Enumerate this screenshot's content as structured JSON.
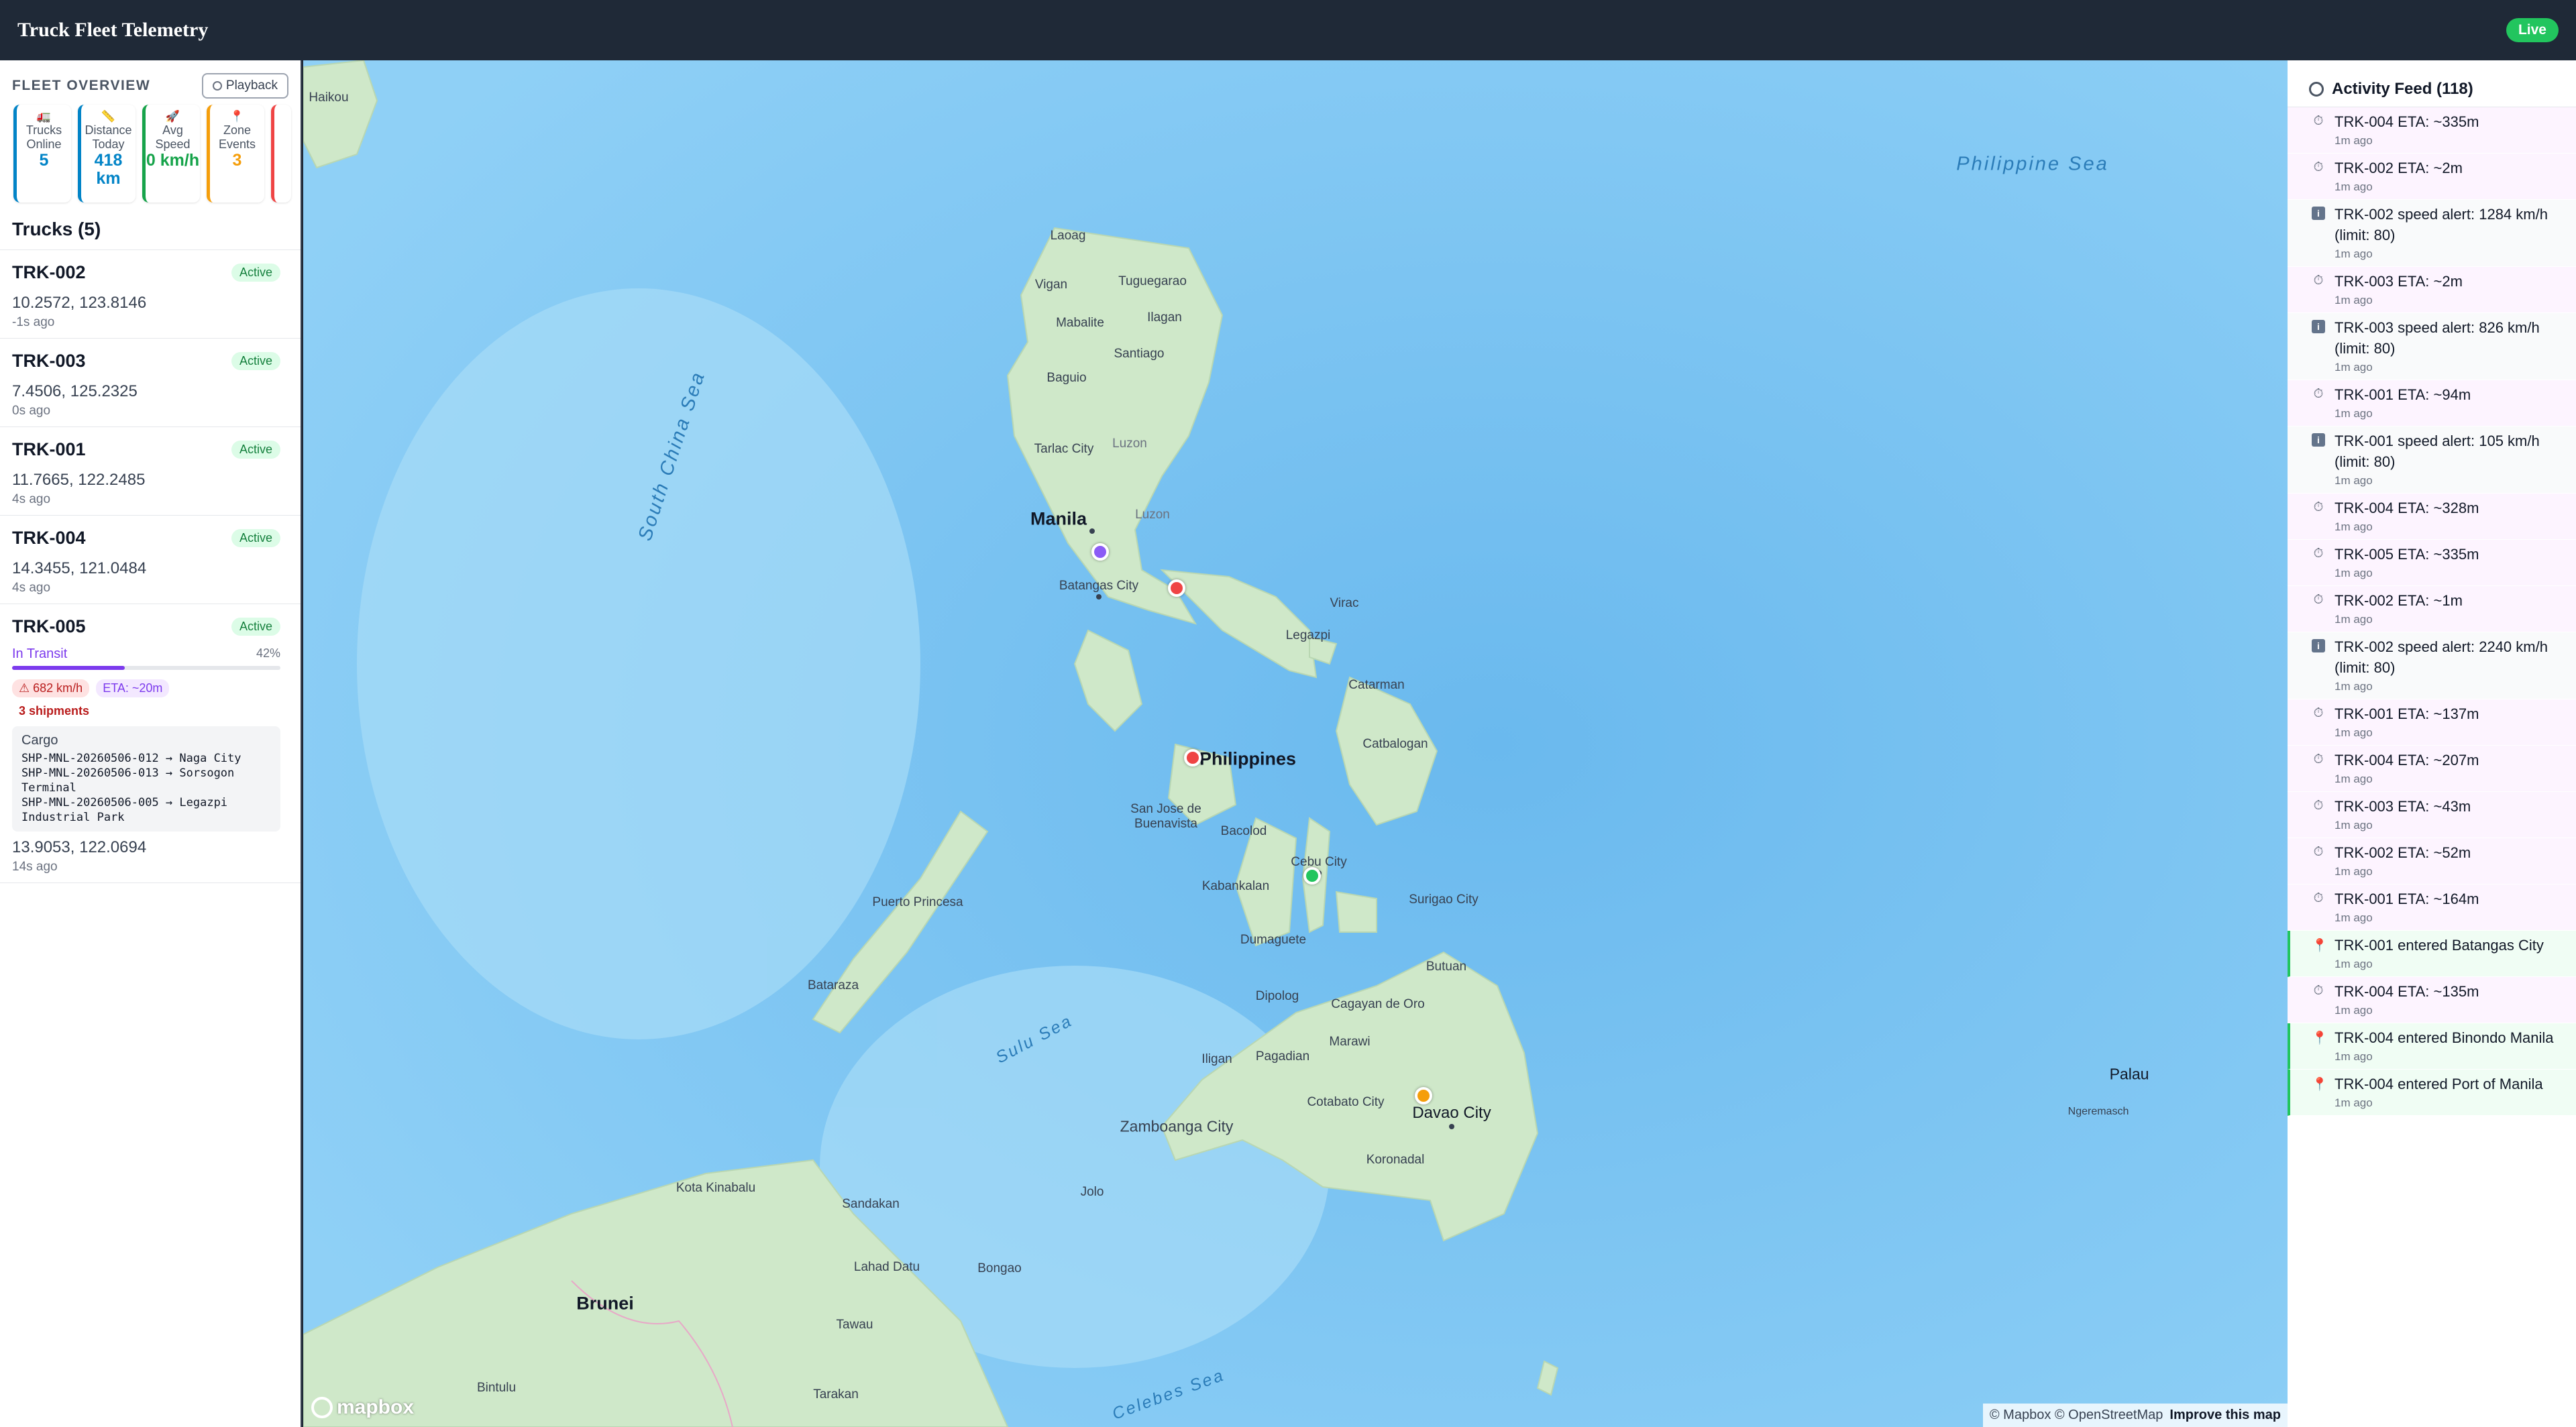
{
  "header": {
    "title": "Truck Fleet Telemetry",
    "live": "Live"
  },
  "overview": {
    "title": "FLEET OVERVIEW",
    "playback": "Playback",
    "stats": [
      {
        "icon": "🚛",
        "label": "Trucks Online",
        "value": "5",
        "color": "#0284c7"
      },
      {
        "icon": "📏",
        "label": "Distance Today",
        "value": "418 km",
        "color": "#0284c7"
      },
      {
        "icon": "🚀",
        "label": "Avg Speed",
        "value": "0 km/h",
        "color": "#16a34a"
      },
      {
        "icon": "📍",
        "label": "Zone Events",
        "value": "3",
        "color": "#f59e0b"
      }
    ]
  },
  "trucks": {
    "title": "Trucks (5)",
    "items": [
      {
        "id": "TRK-002",
        "status": "Active",
        "coords": "10.2572, 123.8146",
        "ago": "-1s ago"
      },
      {
        "id": "TRK-003",
        "status": "Active",
        "coords": "7.4506, 125.2325",
        "ago": "0s ago"
      },
      {
        "id": "TRK-001",
        "status": "Active",
        "coords": "11.7665, 122.2485",
        "ago": "4s ago"
      },
      {
        "id": "TRK-004",
        "status": "Active",
        "coords": "14.3455, 121.0484",
        "ago": "4s ago"
      }
    ],
    "expanded": {
      "id": "TRK-005",
      "status": "Active",
      "transit_label": "In Transit",
      "progress_text": "42%",
      "progress": 42,
      "speed_alert": "⚠ 682 km/h",
      "eta": "ETA: ~20m",
      "shipments": "3 shipments",
      "cargo_title": "Cargo",
      "cargo": [
        "SHP-MNL-20260506-012 → Naga City",
        "SHP-MNL-20260506-013 → Sorsogon Terminal",
        "SHP-MNL-20260506-005 → Legazpi Industrial Park"
      ],
      "coords": "13.9053, 122.0694",
      "ago": "14s ago"
    }
  },
  "map": {
    "seas": [
      "South China Sea",
      "Philippine Sea",
      "Sulu Sea",
      "Celebes Sea"
    ],
    "labels": [
      "Haikou",
      "Laoag",
      "Vigan",
      "Tuguegarao",
      "Mabalite",
      "Ilagan",
      "Santiago",
      "Baguio",
      "Tarlac City",
      "Luzon",
      "Manila",
      "Luzon",
      "Batangas City",
      "Virac",
      "Legazpi",
      "Catarman",
      "Catbalogan",
      "Philippines",
      "San Jose de Buenavista",
      "Bacolod",
      "Cebu City",
      "Kabankalan",
      "Surigao City",
      "Dumaguete",
      "Puerto Princesa",
      "Butuan",
      "Bataraza",
      "Dipolog",
      "Cagayan de Oro",
      "Marawi",
      "Pagadian",
      "Iligan",
      "Cotabato City",
      "Davao City",
      "Zamboanga City",
      "Koronadal",
      "Kota Kinabalu",
      "Jolo",
      "Sandakan",
      "Lahad Datu",
      "Bongao",
      "Brunei",
      "Tawau",
      "Bintulu",
      "Tarakan",
      "Palau",
      "Ngeremasch"
    ],
    "logo": "mapbox",
    "attribution": "© Mapbox © OpenStreetMap",
    "improve": "Improve this map",
    "marker_colors": {
      "trk001": "#ef4444",
      "trk002": "#22c55e",
      "trk003": "#f59e0b",
      "trk004": "#8b5cf6",
      "trk005": "#ef4444"
    }
  },
  "feed": {
    "title": "Activity Feed (118)",
    "items": [
      {
        "type": "eta",
        "text": "TRK-004 ETA: ~335m",
        "ago": "1m ago"
      },
      {
        "type": "eta",
        "text": "TRK-002 ETA: ~2m",
        "ago": "1m ago"
      },
      {
        "type": "speed",
        "text": "TRK-002 speed alert: 1284 km/h (limit: 80)",
        "ago": "1m ago"
      },
      {
        "type": "eta",
        "text": "TRK-003 ETA: ~2m",
        "ago": "1m ago"
      },
      {
        "type": "speed",
        "text": "TRK-003 speed alert: 826 km/h (limit: 80)",
        "ago": "1m ago"
      },
      {
        "type": "eta",
        "text": "TRK-001 ETA: ~94m",
        "ago": "1m ago"
      },
      {
        "type": "speed",
        "text": "TRK-001 speed alert: 105 km/h (limit: 80)",
        "ago": "1m ago"
      },
      {
        "type": "eta",
        "text": "TRK-004 ETA: ~328m",
        "ago": "1m ago"
      },
      {
        "type": "eta",
        "text": "TRK-005 ETA: ~335m",
        "ago": "1m ago"
      },
      {
        "type": "eta",
        "text": "TRK-002 ETA: ~1m",
        "ago": "1m ago"
      },
      {
        "type": "speed",
        "text": "TRK-002 speed alert: 2240 km/h (limit: 80)",
        "ago": "1m ago"
      },
      {
        "type": "eta",
        "text": "TRK-001 ETA: ~137m",
        "ago": "1m ago"
      },
      {
        "type": "eta",
        "text": "TRK-004 ETA: ~207m",
        "ago": "1m ago"
      },
      {
        "type": "eta",
        "text": "TRK-003 ETA: ~43m",
        "ago": "1m ago"
      },
      {
        "type": "eta",
        "text": "TRK-002 ETA: ~52m",
        "ago": "1m ago"
      },
      {
        "type": "eta",
        "text": "TRK-001 ETA: ~164m",
        "ago": "1m ago"
      },
      {
        "type": "zone",
        "text": "TRK-001 entered Batangas City",
        "ago": "1m ago"
      },
      {
        "type": "eta",
        "text": "TRK-004 ETA: ~135m",
        "ago": "1m ago"
      },
      {
        "type": "zone",
        "text": "TRK-004 entered Binondo Manila",
        "ago": "1m ago"
      },
      {
        "type": "zone",
        "text": "TRK-004 entered Port of Manila",
        "ago": "1m ago"
      }
    ]
  }
}
